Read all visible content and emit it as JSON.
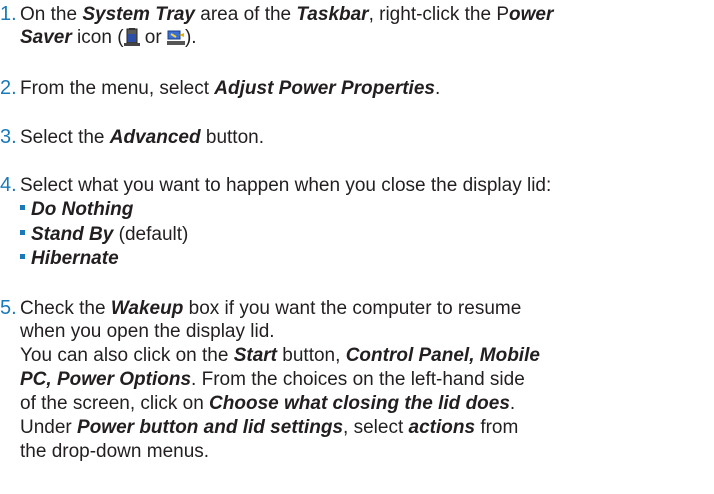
{
  "steps": [
    {
      "number": "1.",
      "line1": {
        "a": "On the ",
        "b": "System Tray",
        "c": " area of the ",
        "d": "Taskbar",
        "e": ", right-click the P",
        "f": "ower"
      },
      "line2": {
        "a": "Saver",
        "b": " icon (",
        "c": " or ",
        "d": ")."
      },
      "icons": [
        "battery-power-icon",
        "plug-power-icon"
      ]
    },
    {
      "number": "2.",
      "a": "From the menu, select ",
      "b": "Adjust Power Properties",
      "c": "."
    },
    {
      "number": "3.",
      "a": "Select the ",
      "b": "Advanced",
      "c": " button."
    },
    {
      "number": "4.",
      "a": "Select what you want to happen when you close the display lid:",
      "options": [
        {
          "label": "Do Nothing",
          "note": ""
        },
        {
          "label": "Stand By",
          "note": " (default)"
        },
        {
          "label": "Hibernate",
          "note": ""
        }
      ]
    },
    {
      "number": "5.",
      "l1": {
        "a": "Check the ",
        "b": "Wakeup",
        "c": " box if you want the computer to resume"
      },
      "l2": "when you open the display lid.",
      "l3": {
        "a": "You can also click on the ",
        "b": "Start",
        "c": " button, ",
        "d": "Control Panel, Mobile"
      },
      "l4": {
        "a": "PC, Power Options",
        "b": ".  From the choices on the left-hand side"
      },
      "l5": "of the screen, click on ",
      "l5b": "Choose what closing the lid does",
      "l5c": ".",
      "l6": {
        "a": "Under ",
        "b": "Power button and lid settings",
        "c": ", select ",
        "d": "actions",
        "e": " from"
      },
      "l7": "the drop-down menus."
    }
  ],
  "colors": {
    "accent": "#1a7ab9",
    "text": "#231f20"
  }
}
